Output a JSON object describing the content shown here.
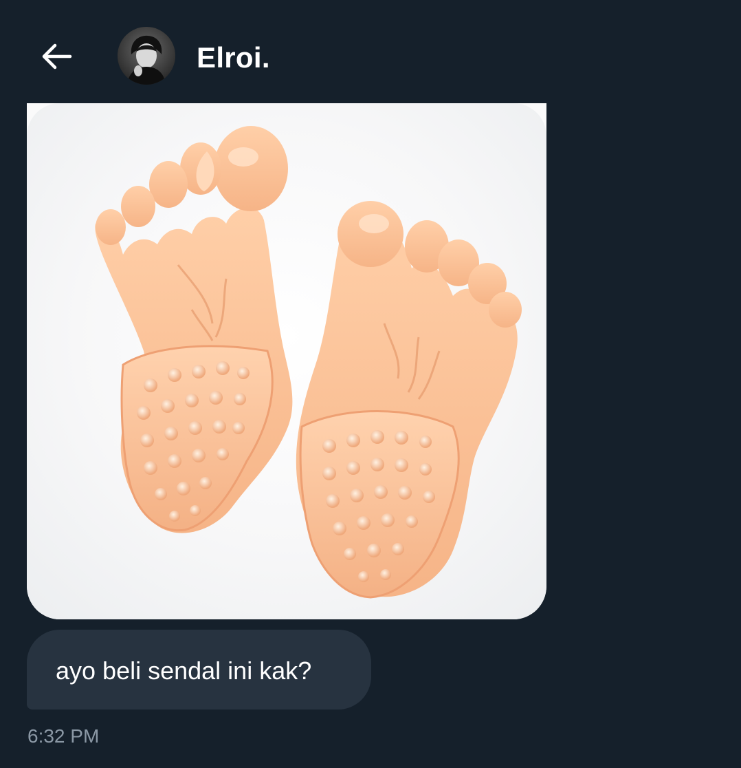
{
  "header": {
    "back_icon": "arrow-left-icon",
    "contact_name": "Elroi."
  },
  "conversation": {
    "messages": [
      {
        "type": "image",
        "image_subject": "foot-shaped-slippers"
      },
      {
        "type": "text",
        "text": "ayo beli sendal ini kak?"
      }
    ],
    "timestamp": "6:32 PM"
  },
  "colors": {
    "background": "#15202b",
    "bubble": "#273340",
    "timestamp": "#8b98a5"
  }
}
